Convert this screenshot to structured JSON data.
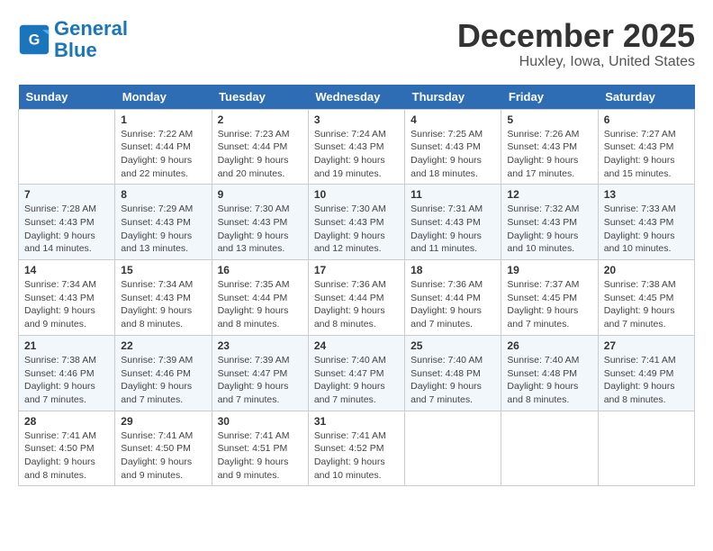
{
  "logo": {
    "line1": "General",
    "line2": "Blue"
  },
  "title": "December 2025",
  "subtitle": "Huxley, Iowa, United States",
  "days_of_week": [
    "Sunday",
    "Monday",
    "Tuesday",
    "Wednesday",
    "Thursday",
    "Friday",
    "Saturday"
  ],
  "weeks": [
    [
      {
        "num": "",
        "info": ""
      },
      {
        "num": "1",
        "info": "Sunrise: 7:22 AM\nSunset: 4:44 PM\nDaylight: 9 hours\nand 22 minutes."
      },
      {
        "num": "2",
        "info": "Sunrise: 7:23 AM\nSunset: 4:44 PM\nDaylight: 9 hours\nand 20 minutes."
      },
      {
        "num": "3",
        "info": "Sunrise: 7:24 AM\nSunset: 4:43 PM\nDaylight: 9 hours\nand 19 minutes."
      },
      {
        "num": "4",
        "info": "Sunrise: 7:25 AM\nSunset: 4:43 PM\nDaylight: 9 hours\nand 18 minutes."
      },
      {
        "num": "5",
        "info": "Sunrise: 7:26 AM\nSunset: 4:43 PM\nDaylight: 9 hours\nand 17 minutes."
      },
      {
        "num": "6",
        "info": "Sunrise: 7:27 AM\nSunset: 4:43 PM\nDaylight: 9 hours\nand 15 minutes."
      }
    ],
    [
      {
        "num": "7",
        "info": "Sunrise: 7:28 AM\nSunset: 4:43 PM\nDaylight: 9 hours\nand 14 minutes."
      },
      {
        "num": "8",
        "info": "Sunrise: 7:29 AM\nSunset: 4:43 PM\nDaylight: 9 hours\nand 13 minutes."
      },
      {
        "num": "9",
        "info": "Sunrise: 7:30 AM\nSunset: 4:43 PM\nDaylight: 9 hours\nand 13 minutes."
      },
      {
        "num": "10",
        "info": "Sunrise: 7:30 AM\nSunset: 4:43 PM\nDaylight: 9 hours\nand 12 minutes."
      },
      {
        "num": "11",
        "info": "Sunrise: 7:31 AM\nSunset: 4:43 PM\nDaylight: 9 hours\nand 11 minutes."
      },
      {
        "num": "12",
        "info": "Sunrise: 7:32 AM\nSunset: 4:43 PM\nDaylight: 9 hours\nand 10 minutes."
      },
      {
        "num": "13",
        "info": "Sunrise: 7:33 AM\nSunset: 4:43 PM\nDaylight: 9 hours\nand 10 minutes."
      }
    ],
    [
      {
        "num": "14",
        "info": "Sunrise: 7:34 AM\nSunset: 4:43 PM\nDaylight: 9 hours\nand 9 minutes."
      },
      {
        "num": "15",
        "info": "Sunrise: 7:34 AM\nSunset: 4:43 PM\nDaylight: 9 hours\nand 8 minutes."
      },
      {
        "num": "16",
        "info": "Sunrise: 7:35 AM\nSunset: 4:44 PM\nDaylight: 9 hours\nand 8 minutes."
      },
      {
        "num": "17",
        "info": "Sunrise: 7:36 AM\nSunset: 4:44 PM\nDaylight: 9 hours\nand 8 minutes."
      },
      {
        "num": "18",
        "info": "Sunrise: 7:36 AM\nSunset: 4:44 PM\nDaylight: 9 hours\nand 7 minutes."
      },
      {
        "num": "19",
        "info": "Sunrise: 7:37 AM\nSunset: 4:45 PM\nDaylight: 9 hours\nand 7 minutes."
      },
      {
        "num": "20",
        "info": "Sunrise: 7:38 AM\nSunset: 4:45 PM\nDaylight: 9 hours\nand 7 minutes."
      }
    ],
    [
      {
        "num": "21",
        "info": "Sunrise: 7:38 AM\nSunset: 4:46 PM\nDaylight: 9 hours\nand 7 minutes."
      },
      {
        "num": "22",
        "info": "Sunrise: 7:39 AM\nSunset: 4:46 PM\nDaylight: 9 hours\nand 7 minutes."
      },
      {
        "num": "23",
        "info": "Sunrise: 7:39 AM\nSunset: 4:47 PM\nDaylight: 9 hours\nand 7 minutes."
      },
      {
        "num": "24",
        "info": "Sunrise: 7:40 AM\nSunset: 4:47 PM\nDaylight: 9 hours\nand 7 minutes."
      },
      {
        "num": "25",
        "info": "Sunrise: 7:40 AM\nSunset: 4:48 PM\nDaylight: 9 hours\nand 7 minutes."
      },
      {
        "num": "26",
        "info": "Sunrise: 7:40 AM\nSunset: 4:48 PM\nDaylight: 9 hours\nand 8 minutes."
      },
      {
        "num": "27",
        "info": "Sunrise: 7:41 AM\nSunset: 4:49 PM\nDaylight: 9 hours\nand 8 minutes."
      }
    ],
    [
      {
        "num": "28",
        "info": "Sunrise: 7:41 AM\nSunset: 4:50 PM\nDaylight: 9 hours\nand 8 minutes."
      },
      {
        "num": "29",
        "info": "Sunrise: 7:41 AM\nSunset: 4:50 PM\nDaylight: 9 hours\nand 9 minutes."
      },
      {
        "num": "30",
        "info": "Sunrise: 7:41 AM\nSunset: 4:51 PM\nDaylight: 9 hours\nand 9 minutes."
      },
      {
        "num": "31",
        "info": "Sunrise: 7:41 AM\nSunset: 4:52 PM\nDaylight: 9 hours\nand 10 minutes."
      },
      {
        "num": "",
        "info": ""
      },
      {
        "num": "",
        "info": ""
      },
      {
        "num": "",
        "info": ""
      }
    ]
  ]
}
